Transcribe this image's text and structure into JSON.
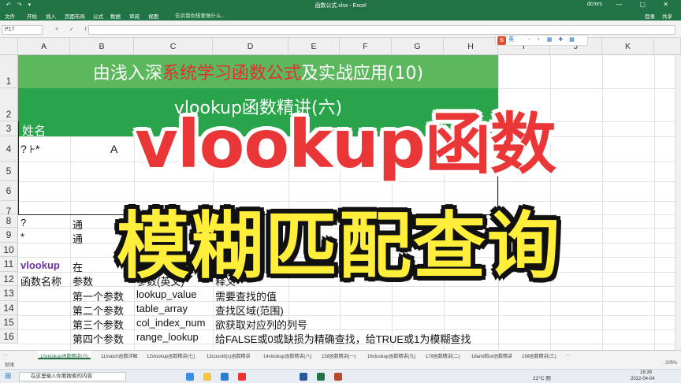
{
  "titlebar": {
    "quick_access": "↶ ↷ ▾",
    "title": "函数公式.xlsx - Excel",
    "user": "dcmrs",
    "window_controls": "— ▢ ✕"
  },
  "ribbon": {
    "tabs": [
      "文件",
      "开始",
      "插入",
      "页面布局",
      "公式",
      "数据",
      "审阅",
      "视图"
    ],
    "tell_me": "告诉我你想要做什么...",
    "login": "登录",
    "share": "共享"
  },
  "formula_bar": {
    "name_box": "P17",
    "fx": "× ✓ fx",
    "value": ""
  },
  "columns": [
    "A",
    "B",
    "C",
    "D",
    "E",
    "F",
    "G",
    "H",
    "I",
    "J",
    "K"
  ],
  "rows": [
    "1",
    "2",
    "3",
    "4",
    "5",
    "6",
    "7",
    "8",
    "9",
    "10",
    "11",
    "12",
    "13",
    "14",
    "15",
    "16"
  ],
  "sheet": {
    "title1_pre": "由浅入深",
    "title1_red": "系统学习函数公式",
    "title1_post": "及实战应用(10)",
    "title2": "vlookup函数精讲(六)",
    "a3": "姓名",
    "a4": "? ⊦*",
    "c4": "A",
    "a8": "?",
    "b8": "通",
    "a9": "*",
    "b9": "通",
    "a11": "vlookup",
    "b11": "在",
    "a12": "函数名称",
    "b12": "参数",
    "c12": "参数(英文)",
    "d12": "释义",
    "b13": "第一个参数",
    "c13": "lookup_value",
    "d13": "需要查找的值",
    "b14": "第二个参数",
    "c14": "table_array",
    "d14": "查找区域(范围)",
    "b15": "第三个参数",
    "c15": "col_index_num",
    "d15": "欲获取对应列的列号",
    "b16": "第四个参数",
    "c16": "range_lookup",
    "d16": "给FALSE或0或缺损为精确查找，给TRUE或1为模糊查找"
  },
  "overlay": {
    "line1": "vlookup函数",
    "line2": "模糊匹配查询"
  },
  "ime": {
    "logo": "S",
    "items": "英 · ◦ ♀ ▦ ✚ ▦"
  },
  "sheet_tabs": [
    "...",
    "10vlookup函数精讲(六)",
    "11match函数详解",
    "12vlookup函数精讲(七)",
    "13countif(s)函数精讲",
    "14vlookup函数精讲(八)",
    "15if函数精讲(一)",
    "16vlookup函数精讲(九)",
    "17if函数精讲(二)",
    "18and和or函数精讲",
    "19if函数精讲(三)",
    "..."
  ],
  "status": {
    "left": "就绪",
    "zoom": "205%"
  },
  "taskbar": {
    "search": "在这里输入你要搜索的内容",
    "weather": "22°C 阴",
    "time": "16:39",
    "date": "2022-04-04"
  },
  "colors": {
    "excel_green": "#217346",
    "title_green": "#5cb85c",
    "header_green": "#2aa44b",
    "title_red": "#e42d2d",
    "overlay_red": "#ea3636",
    "overlay_yellow": "#ffee3a",
    "function_purple": "#7030a0"
  }
}
